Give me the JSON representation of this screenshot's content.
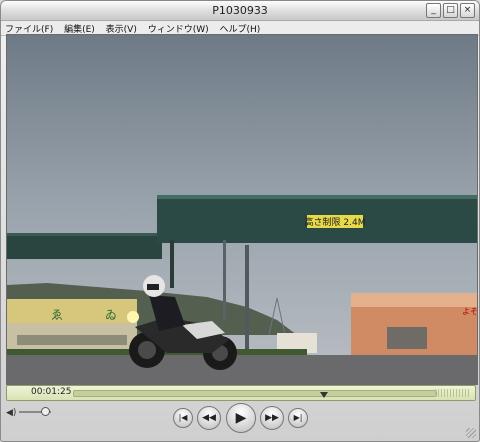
{
  "window": {
    "title": "P1030933"
  },
  "window_buttons": {
    "minimize": "_",
    "maximize": "□",
    "close": "×"
  },
  "menu": [
    "ファイル(F)",
    "編集(E)",
    "表示(V)",
    "ウィンドウ(W)",
    "ヘルプ(H)"
  ],
  "video": {
    "sign_text": "高さ制限 2.4M",
    "shop_text": "よそ"
  },
  "timeline": {
    "current_time": "00:01:25",
    "progress": 0.69
  },
  "controls": {
    "volume_level": 0.82,
    "start_glyph": "|◀",
    "rewind_glyph": "◀◀",
    "play_glyph": "▶",
    "forward_glyph": "▶▶",
    "end_glyph": "▶|"
  },
  "colors": {
    "accent": "#e8d948",
    "timebar": "#dde5b8"
  }
}
